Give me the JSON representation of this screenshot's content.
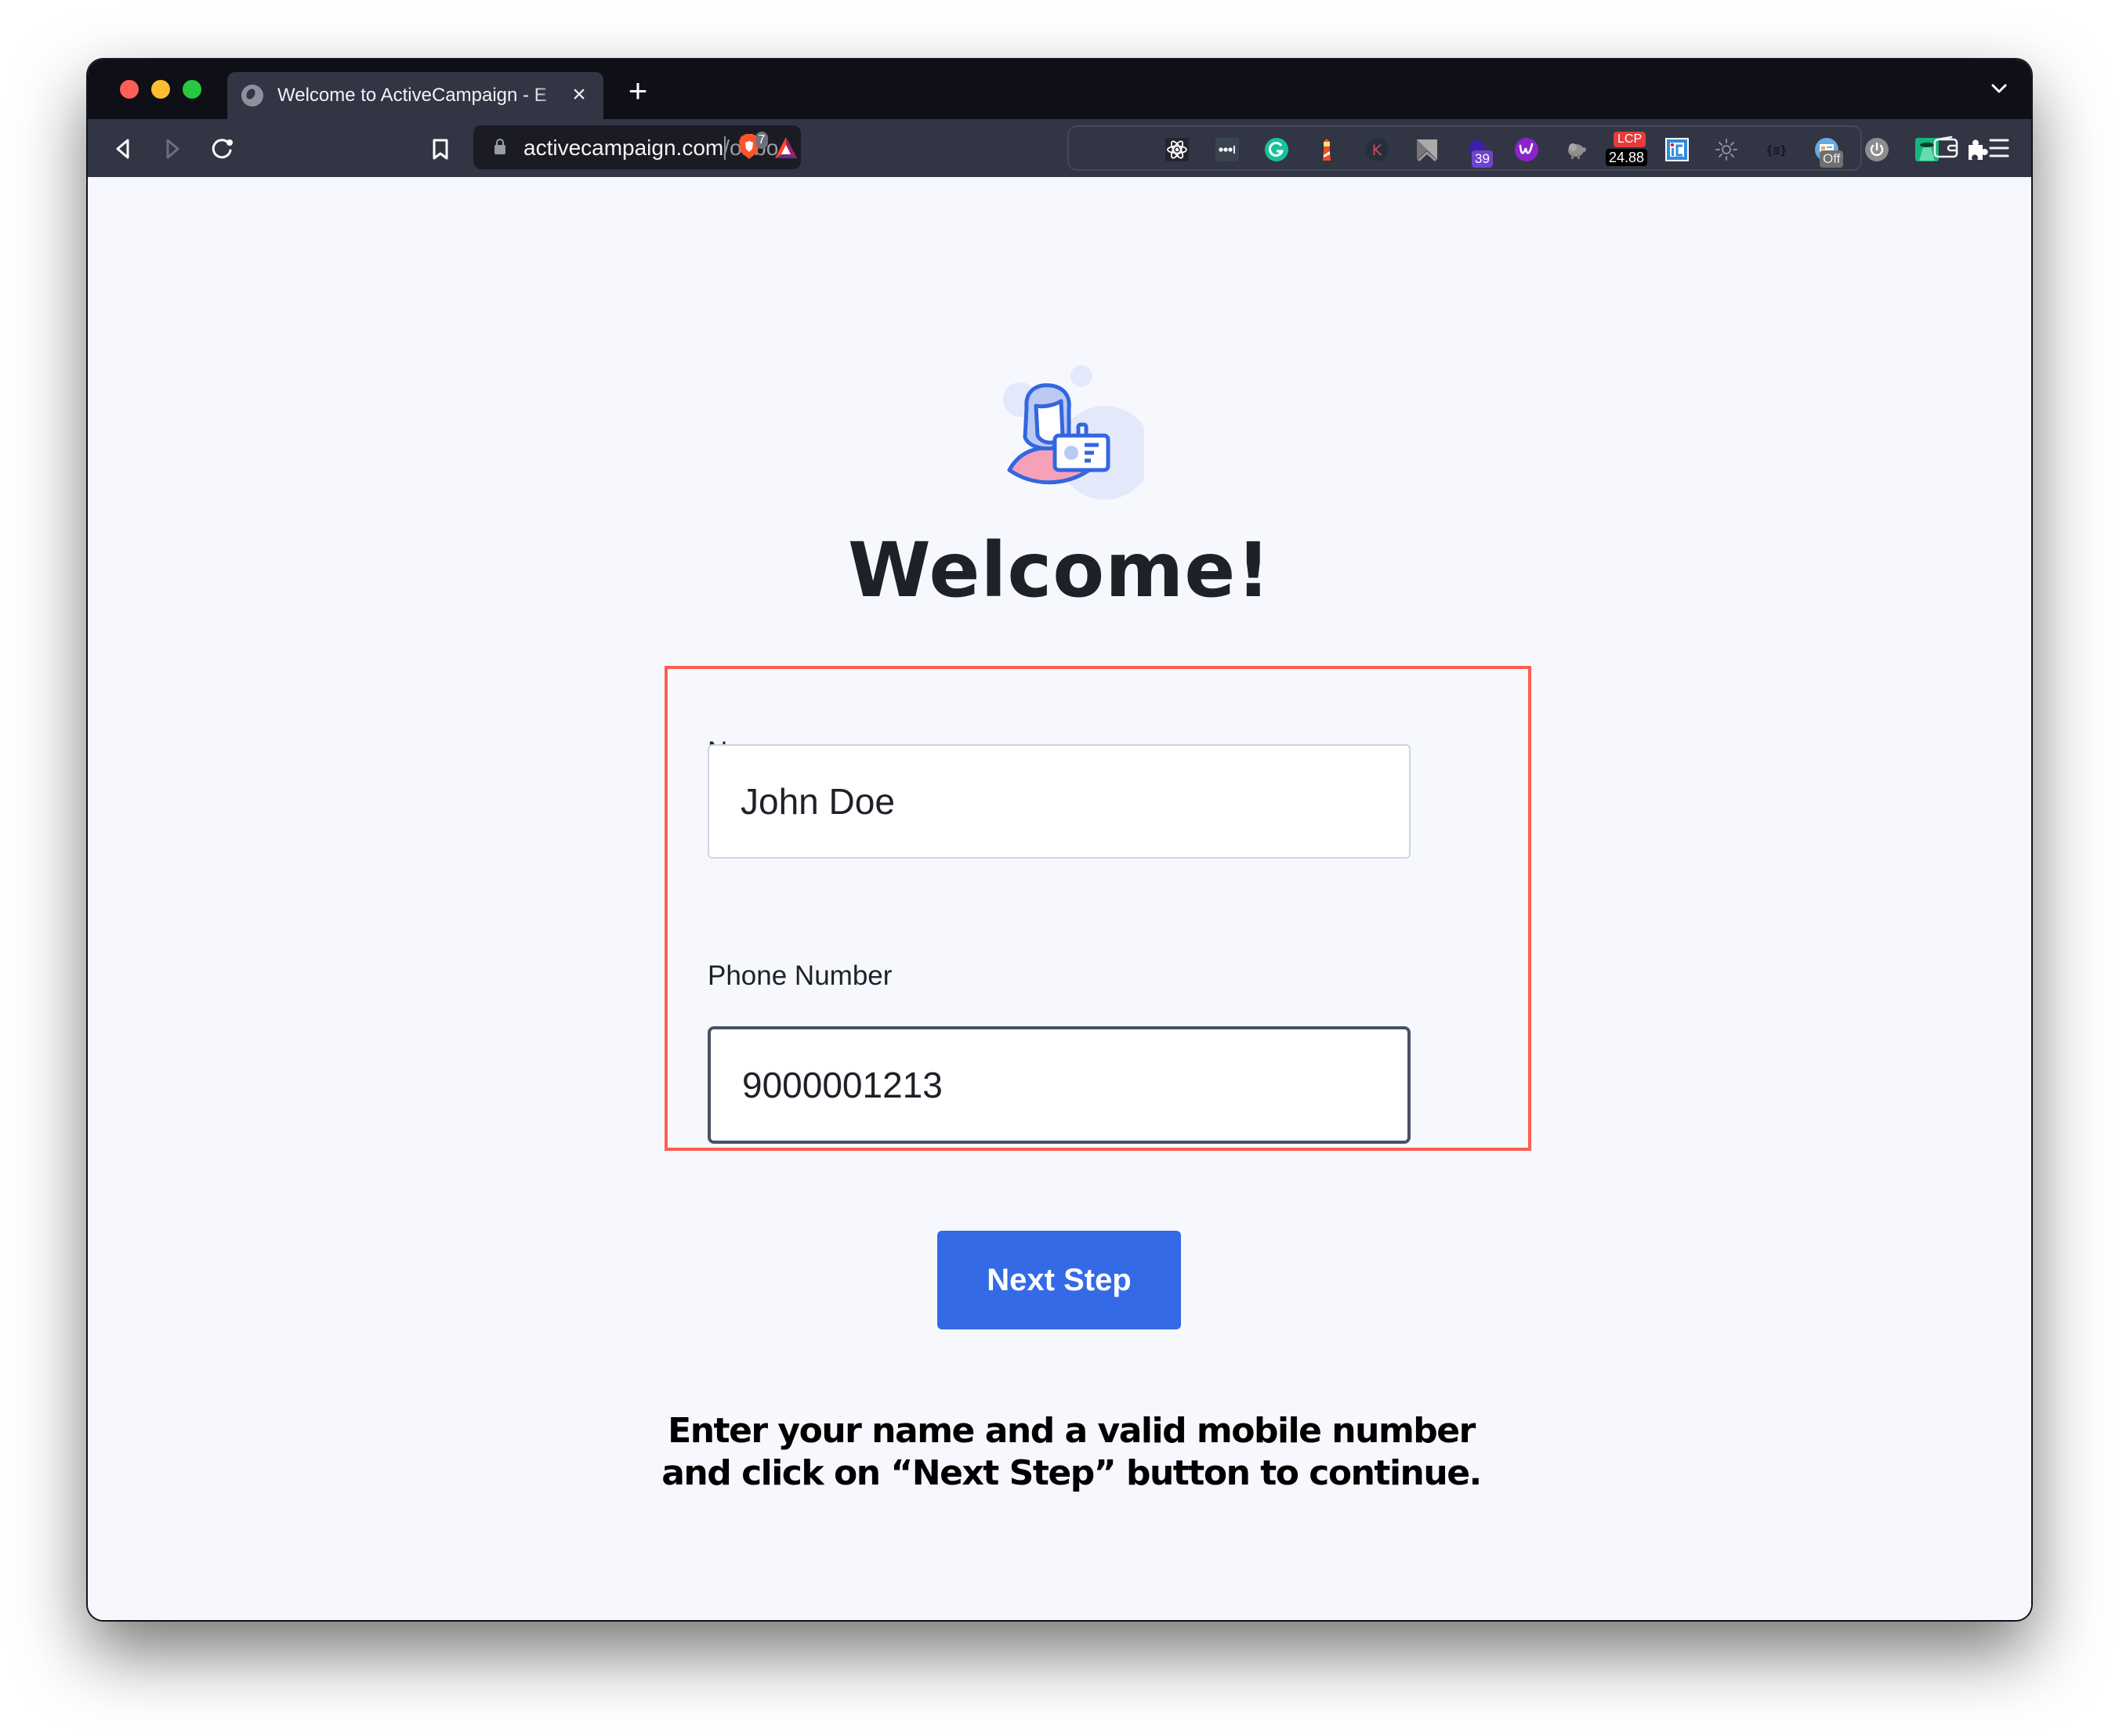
{
  "browser": {
    "tab": {
      "title": "Welcome to ActiveCampaign - E",
      "icon": "globe-icon"
    },
    "new_tab_label": "+",
    "close_tab_label": "×",
    "url": {
      "domain": "activecampaign.com",
      "path": "/onbo..."
    },
    "brave_shields_count": "7",
    "extensions": [
      {
        "name": "react-devtools-icon"
      },
      {
        "name": "lastpass-icon"
      },
      {
        "name": "grammarly-icon"
      },
      {
        "name": "lighthouse-icon"
      },
      {
        "name": "k-extension-icon"
      },
      {
        "name": "arrow-extension-icon"
      },
      {
        "name": "stack-extension-icon",
        "badge": "39"
      },
      {
        "name": "w-extension-icon"
      },
      {
        "name": "elephant-extension-icon"
      },
      {
        "name": "lcp-extension-icon",
        "label": "LCP",
        "badge": "24.88"
      },
      {
        "name": "ic-extension-icon"
      },
      {
        "name": "sun-extension-icon"
      },
      {
        "name": "json-extension-icon",
        "label": "{≡}"
      },
      {
        "name": "screenshot-extension-icon",
        "badge": "Off"
      },
      {
        "name": "power-extension-icon"
      },
      {
        "name": "ufo-extension-icon"
      },
      {
        "name": "puzzle-extensions-icon"
      }
    ],
    "colors": {
      "tabbar_bg": "#0e0f17",
      "toolbar_bg": "#323544"
    }
  },
  "page": {
    "heading": "Welcome!",
    "form": {
      "name_label": "Name",
      "name_value": "John Doe",
      "phone_label": "Phone Number",
      "phone_value": "9000001213"
    },
    "next_button_label": "Next Step",
    "instruction_lines": [
      "Enter your name and a valid mobile number",
      "and click on “Next Step” button to continue."
    ],
    "colors": {
      "accent": "#356ae6",
      "highlight_border": "#fd5e53",
      "background": "#f7f8fd"
    }
  }
}
